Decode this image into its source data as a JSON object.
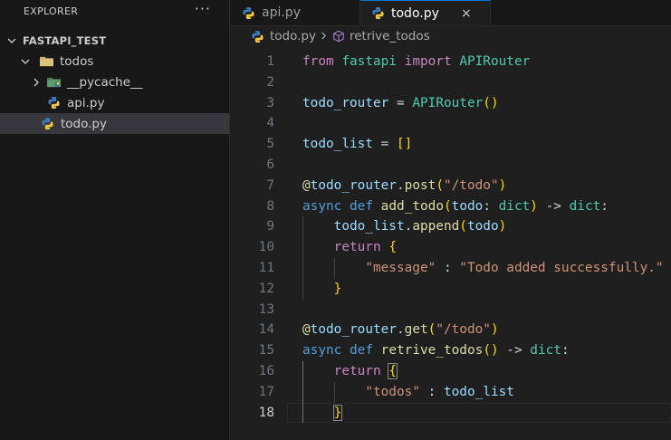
{
  "explorer": {
    "title": "EXPLORER",
    "more_icon": "ellipsis-icon",
    "project": "FASTAPI_TEST",
    "items": [
      {
        "label": "todos",
        "icon": "folder-icon"
      },
      {
        "label": "__pycache__",
        "icon": "pycache-folder-icon"
      },
      {
        "label": "api.py",
        "icon": "python-file-icon"
      },
      {
        "label": "todo.py",
        "icon": "python-file-icon"
      }
    ]
  },
  "tabs": [
    {
      "label": "api.py",
      "active": false
    },
    {
      "label": "todo.py",
      "active": true,
      "close": "×"
    }
  ],
  "breadcrumb": {
    "file": "todo.py",
    "symbol": "retrive_todos"
  },
  "code": {
    "line_numbers": [
      "1",
      "2",
      "3",
      "4",
      "5",
      "6",
      "7",
      "8",
      "9",
      "10",
      "11",
      "12",
      "13",
      "14",
      "15",
      "16",
      "17",
      "18"
    ],
    "current_line": 18,
    "lines": [
      [
        [
          "kw2",
          "from"
        ],
        [
          "op",
          " "
        ],
        [
          "cls",
          "fastapi"
        ],
        [
          "op",
          " "
        ],
        [
          "kw2",
          "import"
        ],
        [
          "op",
          " "
        ],
        [
          "cls",
          "APIRouter"
        ]
      ],
      [],
      [
        [
          "var",
          "todo_router"
        ],
        [
          "op",
          " = "
        ],
        [
          "cls",
          "APIRouter"
        ],
        [
          "b1",
          "()"
        ]
      ],
      [],
      [
        [
          "var",
          "todo_list"
        ],
        [
          "op",
          " = "
        ],
        [
          "b1",
          "[]"
        ]
      ],
      [],
      [
        [
          "deco",
          "@"
        ],
        [
          "var",
          "todo_router"
        ],
        [
          "op",
          "."
        ],
        [
          "fn",
          "post"
        ],
        [
          "b1",
          "("
        ],
        [
          "str",
          "\"/todo\""
        ],
        [
          "b1",
          ")"
        ]
      ],
      [
        [
          "kw",
          "async"
        ],
        [
          "op",
          " "
        ],
        [
          "kw",
          "def"
        ],
        [
          "op",
          " "
        ],
        [
          "fn",
          "add_todo"
        ],
        [
          "b1",
          "("
        ],
        [
          "var",
          "todo"
        ],
        [
          "op",
          ": "
        ],
        [
          "cls",
          "dict"
        ],
        [
          "b1",
          ")"
        ],
        [
          "op",
          " -> "
        ],
        [
          "cls",
          "dict"
        ],
        [
          "op",
          ":"
        ]
      ],
      [
        [
          "op",
          "    "
        ],
        [
          "var",
          "todo_list"
        ],
        [
          "op",
          "."
        ],
        [
          "fn",
          "append"
        ],
        [
          "b1",
          "("
        ],
        [
          "var",
          "todo"
        ],
        [
          "b1",
          ")"
        ]
      ],
      [
        [
          "op",
          "    "
        ],
        [
          "kw2",
          "return"
        ],
        [
          "op",
          " "
        ],
        [
          "b1",
          "{"
        ]
      ],
      [
        [
          "op",
          "        "
        ],
        [
          "str",
          "\"message\""
        ],
        [
          "op",
          " : "
        ],
        [
          "str",
          "\"Todo added successfully.\""
        ]
      ],
      [
        [
          "op",
          "    "
        ],
        [
          "b1",
          "}"
        ]
      ],
      [],
      [
        [
          "deco",
          "@"
        ],
        [
          "var",
          "todo_router"
        ],
        [
          "op",
          "."
        ],
        [
          "fn",
          "get"
        ],
        [
          "b1",
          "("
        ],
        [
          "str",
          "\"/todo\""
        ],
        [
          "b1",
          ")"
        ]
      ],
      [
        [
          "kw",
          "async"
        ],
        [
          "op",
          " "
        ],
        [
          "kw",
          "def"
        ],
        [
          "op",
          " "
        ],
        [
          "fn",
          "retrive_todos"
        ],
        [
          "b1",
          "()"
        ],
        [
          "op",
          " -> "
        ],
        [
          "cls",
          "dict"
        ],
        [
          "op",
          ":"
        ]
      ],
      [
        [
          "op",
          "    "
        ],
        [
          "kw2",
          "return"
        ],
        [
          "op",
          " "
        ],
        [
          "b1m",
          "{"
        ]
      ],
      [
        [
          "op",
          "        "
        ],
        [
          "str",
          "\"todos\""
        ],
        [
          "op",
          " : "
        ],
        [
          "var",
          "todo_list"
        ]
      ],
      [
        [
          "op",
          "    "
        ],
        [
          "b1m",
          "}"
        ]
      ]
    ]
  }
}
